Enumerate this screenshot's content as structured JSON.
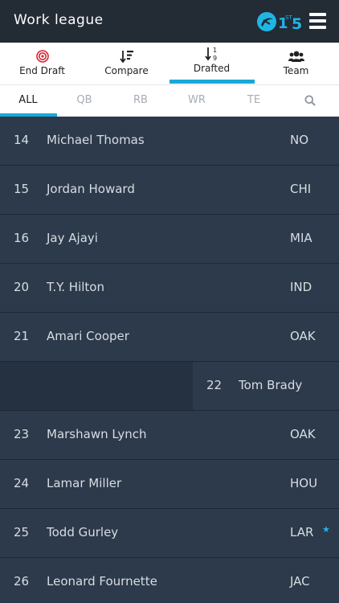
{
  "header": {
    "title": "Work league",
    "logo_text": "1st5"
  },
  "toolbar": {
    "items": [
      {
        "label": "End Draft",
        "icon": "target-icon"
      },
      {
        "label": "Compare",
        "icon": "sort-compare-icon"
      },
      {
        "label": "Drafted",
        "icon": "sort-numeric-icon",
        "active": true
      },
      {
        "label": "Team",
        "icon": "users-icon"
      }
    ]
  },
  "filters": {
    "items": [
      "ALL",
      "QB",
      "RB",
      "WR",
      "TE"
    ],
    "active": "ALL",
    "search_icon": "search-icon"
  },
  "colors": {
    "accent": "#19a8d8",
    "row_bg": "#2c3a4b",
    "header_bg": "#232b35",
    "star": "#1fb5e5"
  },
  "picks": [
    {
      "num": "14",
      "name": "Michael Thomas",
      "team": "NO"
    },
    {
      "num": "15",
      "name": "Jordan Howard",
      "team": "CHI"
    },
    {
      "num": "16",
      "name": "Jay Ajayi",
      "team": "MIA"
    },
    {
      "num": "20",
      "name": "T.Y. Hilton",
      "team": "IND"
    },
    {
      "num": "21",
      "name": "Amari Cooper",
      "team": "OAK"
    },
    {
      "num": "22",
      "name": "Tom Brady",
      "team": "",
      "mine": true
    },
    {
      "num": "23",
      "name": "Marshawn Lynch",
      "team": "OAK"
    },
    {
      "num": "24",
      "name": "Lamar Miller",
      "team": "HOU"
    },
    {
      "num": "25",
      "name": "Todd Gurley",
      "team": "LAR",
      "starred": true
    },
    {
      "num": "26",
      "name": "Leonard Fournette",
      "team": "JAC"
    }
  ]
}
